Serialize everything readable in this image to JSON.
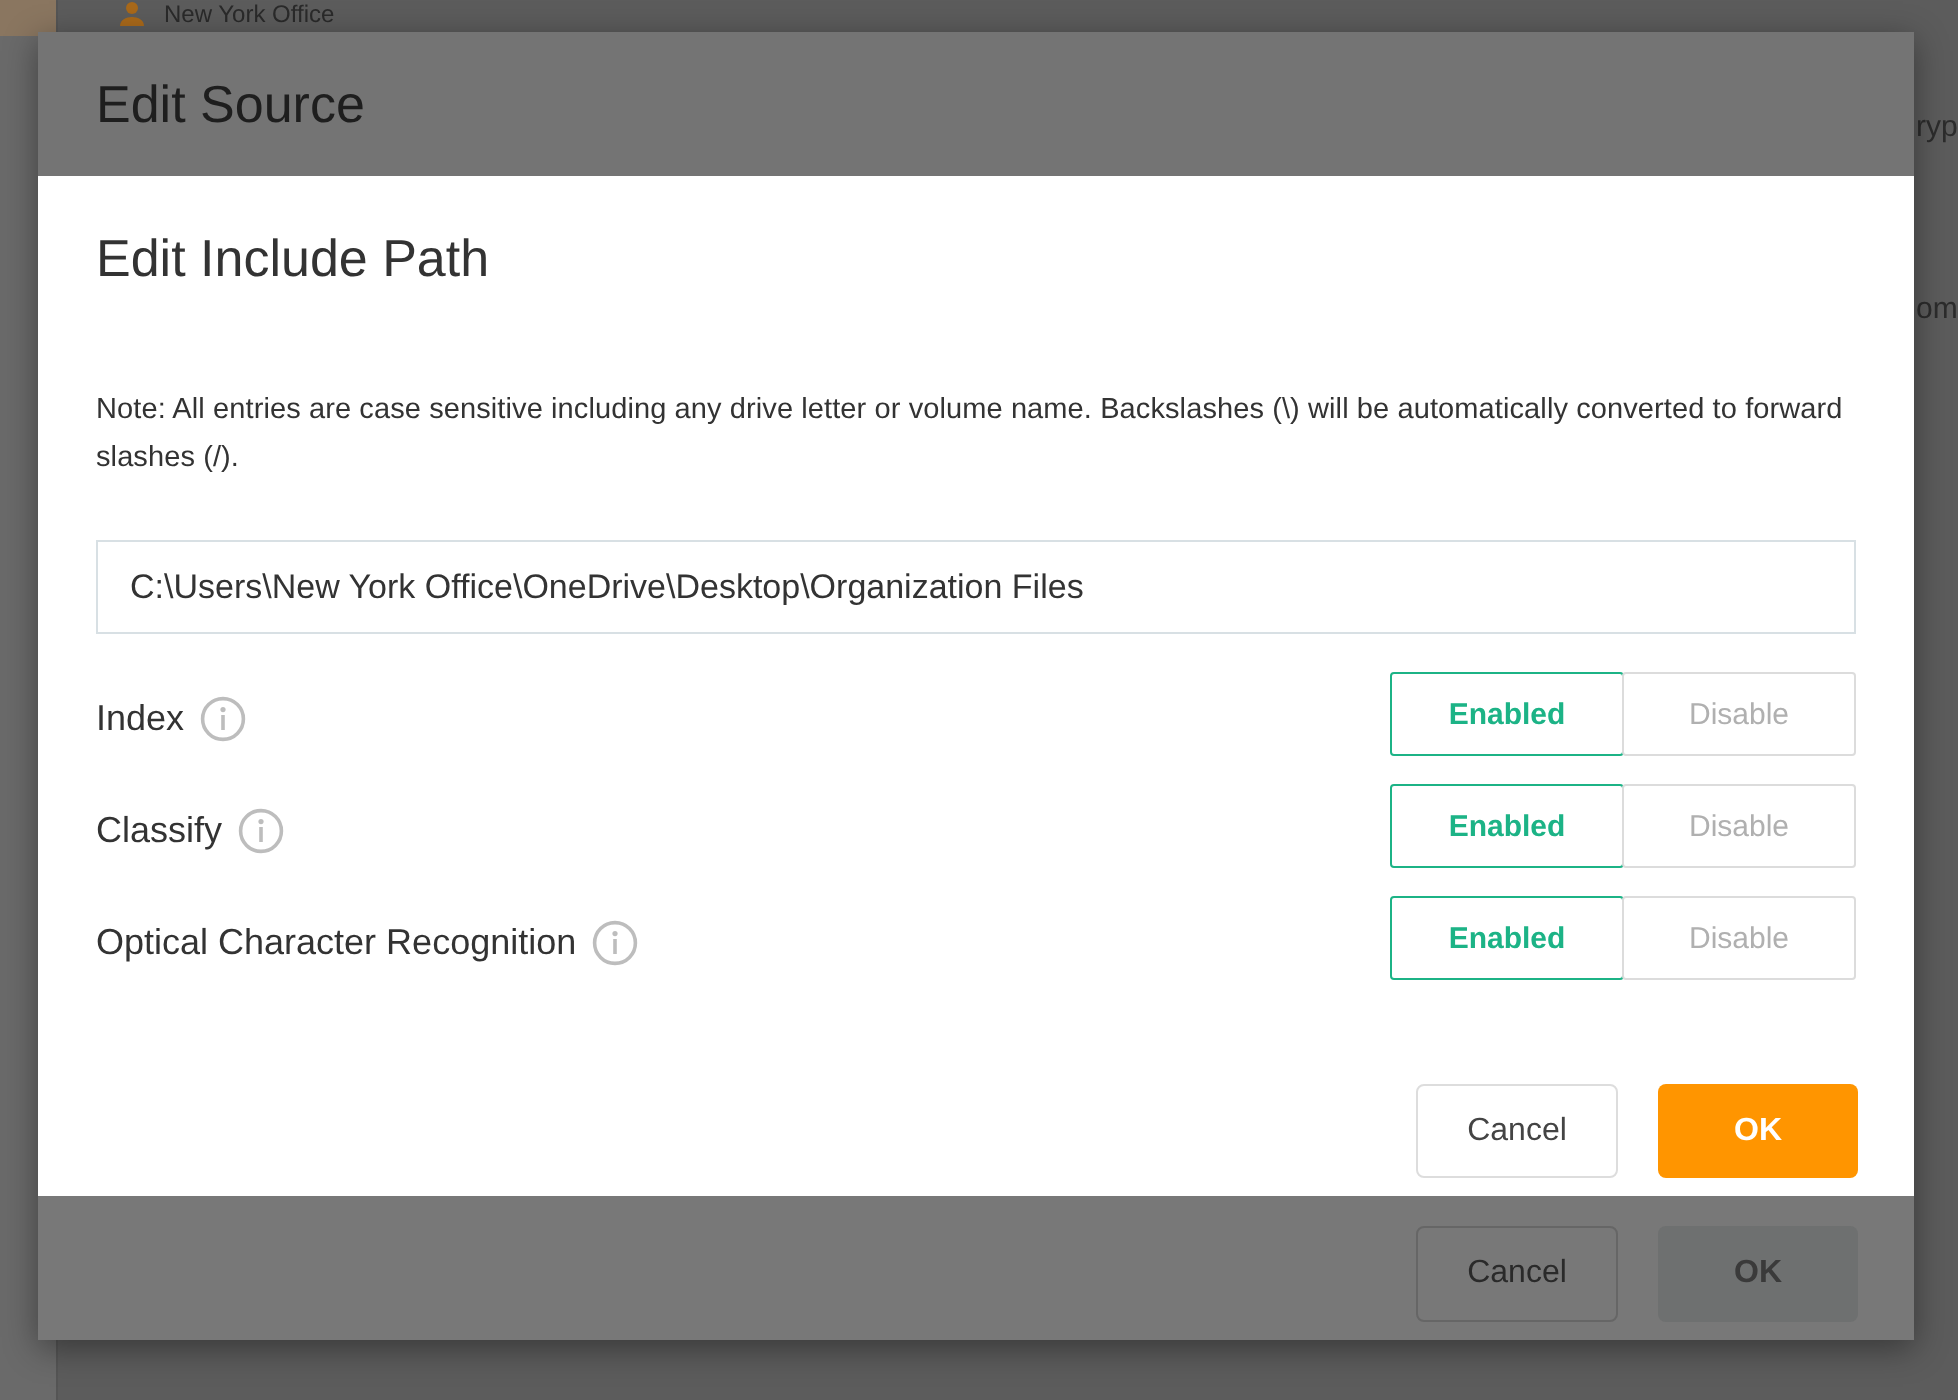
{
  "background": {
    "top_item": {
      "label": "New York Office"
    },
    "fragments": [
      "ryp",
      "om"
    ],
    "dialog": {
      "title": "Edit Source",
      "buttons": [
        {
          "label": "Cancel",
          "kind": "secondary"
        },
        {
          "label": "OK",
          "kind": "primary"
        }
      ]
    }
  },
  "dialog": {
    "title": "Edit Include Path",
    "note": "Note: All entries are case sensitive including any drive letter or volume name. Backslashes (\\) will be automatically converted to forward slashes (/).",
    "path": {
      "value": "C:\\Users\\New York Office\\OneDrive\\Desktop\\Organization Files"
    },
    "rows": [
      {
        "label": "Index",
        "options": [
          {
            "label": "Enabled",
            "selected": true
          },
          {
            "label": "Disable",
            "selected": false
          }
        ]
      },
      {
        "label": "Classify",
        "options": [
          {
            "label": "Enabled",
            "selected": true
          },
          {
            "label": "Disable",
            "selected": false
          }
        ]
      },
      {
        "label": "Optical Character Recognition",
        "options": [
          {
            "label": "Enabled",
            "selected": true
          },
          {
            "label": "Disable",
            "selected": false
          }
        ]
      }
    ],
    "buttons": [
      {
        "label": "Cancel",
        "kind": "secondary"
      },
      {
        "label": "OK",
        "kind": "primary"
      }
    ]
  }
}
